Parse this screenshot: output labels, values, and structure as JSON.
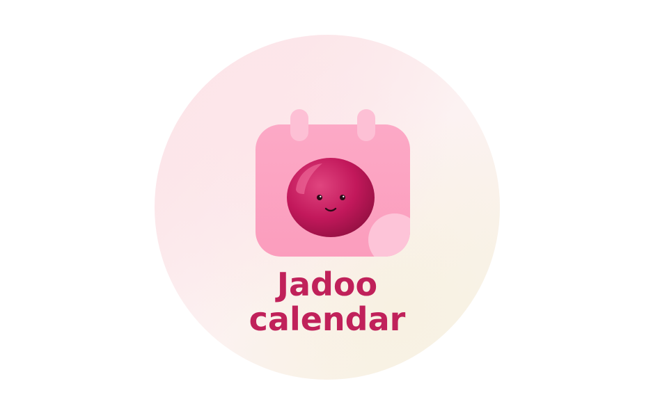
{
  "brand": {
    "name_line_1": "Jadoo",
    "name_line_2": "calendar",
    "text_color": "#c0215a",
    "icon_color": "#fca5c4",
    "plum_color": "#c2185b",
    "icon": "calendar-plum-mascot-icon"
  }
}
